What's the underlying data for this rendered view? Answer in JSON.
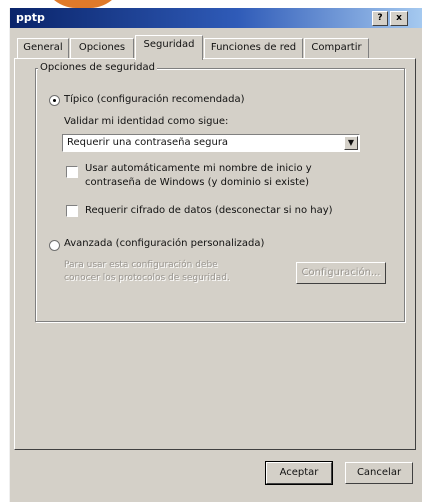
{
  "window": {
    "title": "pptp",
    "help_button": "?",
    "close_button": "x"
  },
  "tabs": [
    {
      "label": "General"
    },
    {
      "label": "Opciones"
    },
    {
      "label": "Seguridad"
    },
    {
      "label": "Funciones de red"
    },
    {
      "label": "Compartir"
    }
  ],
  "active_tab": "Seguridad",
  "security": {
    "group_title": "Opciones de seguridad",
    "typical_radio": {
      "label": "Típico (configuración recomendada)",
      "checked": true
    },
    "validate_label": "Validar mi identidad como sigue:",
    "validate_select": {
      "value": "Requerir una contraseña segura"
    },
    "auto_logon_checkbox": {
      "label_line1": "Usar automáticamente mi nombre de inicio y",
      "label_line2": "contraseña de Windows (y dominio si existe)",
      "checked": false
    },
    "encryption_checkbox": {
      "label": "Requerir cifrado de datos (desconectar si no hay)",
      "checked": false
    },
    "advanced_radio": {
      "label": "Avanzada (configuración personalizada)",
      "checked": false
    },
    "advanced_desc_line1": "Para usar esta configuración debe",
    "advanced_desc_line2": "conocer los protocolos de seguridad.",
    "config_button": "Configuración..."
  },
  "footer": {
    "accept_button": "Aceptar",
    "cancel_button": "Cancelar"
  },
  "colors": {
    "title_bar": "#0a246a",
    "dialog_bg": "#d4d0c8",
    "accent_blob": "#e07a2a"
  }
}
